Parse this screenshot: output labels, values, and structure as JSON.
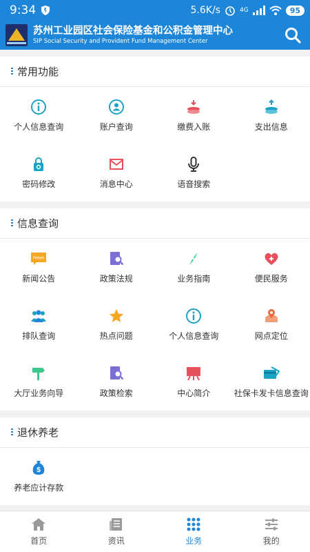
{
  "status": {
    "time": "9:34",
    "speed": "5.6K/s",
    "net": "4G",
    "battery": "95"
  },
  "header": {
    "title": "苏州工业园区社会保险基金和公积金管理中心",
    "subtitle": "SIP Social Security and Provident Fund Management Center"
  },
  "sections": [
    {
      "title": "常用功能",
      "items": [
        {
          "label": "个人信息查询",
          "icon": "info-icon"
        },
        {
          "label": "账户查询",
          "icon": "user-icon"
        },
        {
          "label": "缴费入账",
          "icon": "deposit-icon"
        },
        {
          "label": "支出信息",
          "icon": "withdraw-icon"
        },
        {
          "label": "密码修改",
          "icon": "lock-icon"
        },
        {
          "label": "消息中心",
          "icon": "mail-icon"
        },
        {
          "label": "语音搜索",
          "icon": "mic-icon"
        }
      ]
    },
    {
      "title": "信息查询",
      "items": [
        {
          "label": "新闻公告",
          "icon": "news-icon",
          "badge": "News"
        },
        {
          "label": "政策法规",
          "icon": "policy-search-icon"
        },
        {
          "label": "业务指南",
          "icon": "compass-icon"
        },
        {
          "label": "便民服务",
          "icon": "heart-icon"
        },
        {
          "label": "排队查询",
          "icon": "queue-icon"
        },
        {
          "label": "热点问题",
          "icon": "star-icon"
        },
        {
          "label": "个人信息查询",
          "icon": "info-icon"
        },
        {
          "label": "网点定位",
          "icon": "location-icon"
        },
        {
          "label": "大厅业务向导",
          "icon": "signpost-icon"
        },
        {
          "label": "政策检索",
          "icon": "policy-search-icon"
        },
        {
          "label": "中心简介",
          "icon": "board-icon"
        },
        {
          "label": "社保卡发卡信息查询",
          "icon": "card-icon"
        }
      ]
    },
    {
      "title": "退休养老",
      "items": [
        {
          "label": "养老应计存款",
          "icon": "money-bag-icon",
          "symbol": "$"
        }
      ]
    }
  ],
  "tabs": [
    {
      "label": "首页",
      "icon": "home-icon"
    },
    {
      "label": "资讯",
      "icon": "news-list-icon"
    },
    {
      "label": "业务",
      "icon": "grid-icon",
      "active": true
    },
    {
      "label": "我的",
      "icon": "settings-sliders-icon"
    }
  ],
  "colors": {
    "primary": "#1e86d9",
    "teal": "#1aa3c5",
    "red": "#e8505b",
    "orange": "#f5a623",
    "green": "#3cc98a",
    "purple": "#7b6fd6"
  }
}
